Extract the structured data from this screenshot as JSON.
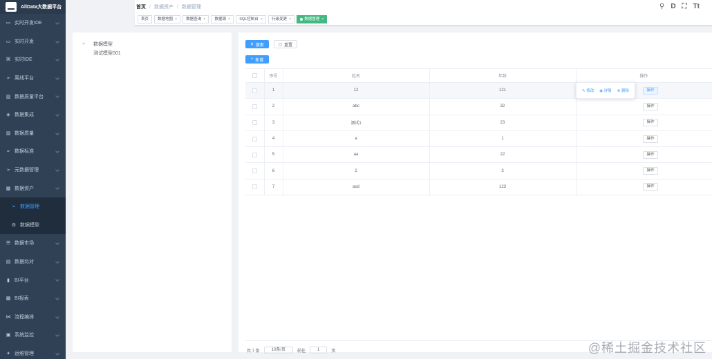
{
  "app": {
    "title": "AllData大数据平台"
  },
  "sidebar": {
    "items": [
      {
        "label": "实时开发IDE",
        "icon": "monitor-icon",
        "glyph": "▭"
      },
      {
        "label": "实时开发",
        "icon": "monitor-icon",
        "glyph": "▭"
      },
      {
        "label": "实时IDE",
        "icon": "ide-icon",
        "glyph": "⌘"
      },
      {
        "label": "离线平台",
        "icon": "send-icon",
        "glyph": "➢"
      },
      {
        "label": "数据质量平台",
        "icon": "chart-icon",
        "glyph": "▥"
      },
      {
        "label": "数据集成",
        "icon": "box-icon",
        "glyph": "◈"
      },
      {
        "label": "数据质量",
        "icon": "chart-icon",
        "glyph": "▥"
      },
      {
        "label": "数据标准",
        "icon": "send-icon",
        "glyph": "➢"
      },
      {
        "label": "元数据管理",
        "icon": "send-icon",
        "glyph": "➢"
      },
      {
        "label": "数据资产",
        "icon": "grid-icon",
        "glyph": "▦"
      },
      {
        "label": "数据管理",
        "icon": "send-icon",
        "glyph": "➢",
        "sub": true,
        "active": true
      },
      {
        "label": "数据模型",
        "icon": "gear-icon",
        "glyph": "⚙",
        "sub": true
      },
      {
        "label": "数据市场",
        "icon": "list-icon",
        "glyph": "☰"
      },
      {
        "label": "数据比对",
        "icon": "compare-icon",
        "glyph": "▤"
      },
      {
        "label": "BI平台",
        "icon": "bar-chart-icon",
        "glyph": "▮"
      },
      {
        "label": "BI报表",
        "icon": "report-icon",
        "glyph": "▩"
      },
      {
        "label": "流程编排",
        "icon": "flow-icon",
        "glyph": "⋈"
      },
      {
        "label": "系统监控",
        "icon": "monitor-icon",
        "glyph": "▣"
      },
      {
        "label": "运维管理",
        "icon": "tool-icon",
        "glyph": "✦"
      }
    ]
  },
  "breadcrumb": [
    "首页",
    "数据资产",
    "数据管理"
  ],
  "header_icons": [
    {
      "name": "search-icon",
      "glyph": "⚲"
    },
    {
      "name": "doc-icon",
      "glyph": "D"
    },
    {
      "name": "fullscreen-icon",
      "glyph": "⛶"
    },
    {
      "name": "font-size-icon",
      "glyph": "Tt"
    }
  ],
  "tags": [
    {
      "label": "首页"
    },
    {
      "label": "数据地图",
      "closable": true
    },
    {
      "label": "数据查询",
      "closable": true
    },
    {
      "label": "数据源",
      "closable": true
    },
    {
      "label": "SQL控制台",
      "closable": true
    },
    {
      "label": "行级变更",
      "closable": true
    },
    {
      "label": "数据管理",
      "closable": true,
      "active": true
    }
  ],
  "tree": {
    "root": "数据模型",
    "child": "测试模型001"
  },
  "toolbar": {
    "search_label": "搜索",
    "reset_label": "重置",
    "add_label": "新增"
  },
  "table": {
    "columns": [
      "序号",
      "姓名",
      "年龄",
      "操作"
    ],
    "rows": [
      {
        "no": "1",
        "name": "12",
        "age": "121"
      },
      {
        "no": "2",
        "name": "abc",
        "age": "32"
      },
      {
        "no": "3",
        "name": "测试1",
        "age": "23"
      },
      {
        "no": "4",
        "name": "a",
        "age": "1"
      },
      {
        "no": "5",
        "name": "aa",
        "age": "22"
      },
      {
        "no": "6",
        "name": "2",
        "age": "3"
      },
      {
        "no": "7",
        "name": "asd",
        "age": "123"
      }
    ],
    "op_label": "操作",
    "popover": {
      "edit": "修改",
      "detail": "详情",
      "delete": "删除"
    }
  },
  "pager": {
    "total": "共 7 条",
    "size": "10条/页",
    "goto": "前往",
    "unit": "页"
  },
  "watermark": "@稀土掘金技术社区"
}
